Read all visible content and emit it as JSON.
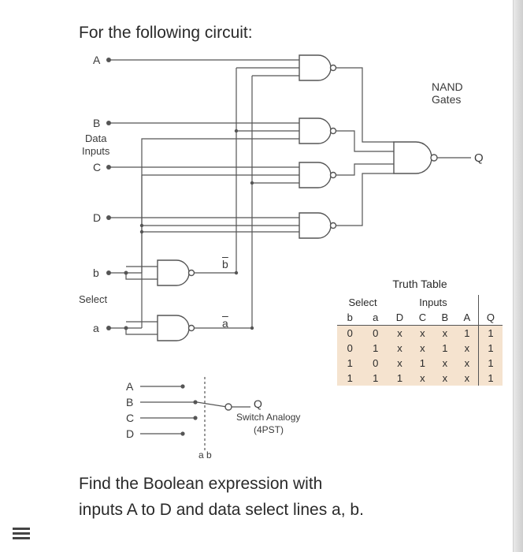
{
  "title": "For the following circuit:",
  "inputs": {
    "A": "A",
    "B": "B",
    "C": "C",
    "D": "D"
  },
  "data_inputs_label1": "Data",
  "data_inputs_label2": "Inputs",
  "select_label": "Select",
  "select_lines": {
    "b": "b",
    "a": "a",
    "b_bar": "b",
    "a_bar": "a"
  },
  "nand_gates_label1": "NAND",
  "nand_gates_label2": "Gates",
  "output_label": "Q",
  "switch": {
    "inputs": {
      "A": "A",
      "B": "B",
      "C": "C",
      "D": "D"
    },
    "output": "Q",
    "label1": "Switch Analogy",
    "label2": "(4PST)",
    "control": "a b"
  },
  "truth_table": {
    "title": "Truth Table",
    "group_select": "Select",
    "group_inputs": "Inputs",
    "cols": [
      "b",
      "a",
      "D",
      "C",
      "B",
      "A",
      "Q"
    ],
    "rows": [
      [
        "0",
        "0",
        "x",
        "x",
        "x",
        "1",
        "1"
      ],
      [
        "0",
        "1",
        "x",
        "x",
        "1",
        "x",
        "1"
      ],
      [
        "1",
        "0",
        "x",
        "1",
        "x",
        "x",
        "1"
      ],
      [
        "1",
        "1",
        "1",
        "x",
        "x",
        "x",
        "1"
      ]
    ]
  },
  "bottom_prompt_line1": "Find the Boolean expression with",
  "bottom_prompt_line2": "inputs A to D and data select lines a, b.",
  "chart_data": {
    "type": "table",
    "title": "4-to-1 Multiplexer (NAND implementation) Truth Table",
    "columns": [
      "b",
      "a",
      "D",
      "C",
      "B",
      "A",
      "Q"
    ],
    "rows": [
      [
        0,
        0,
        "x",
        "x",
        "x",
        1,
        1
      ],
      [
        0,
        1,
        "x",
        "x",
        1,
        "x",
        1
      ],
      [
        1,
        0,
        "x",
        1,
        "x",
        "x",
        1
      ],
      [
        1,
        1,
        1,
        "x",
        "x",
        "x",
        1
      ]
    ],
    "inputs": {
      "data": [
        "A",
        "B",
        "C",
        "D"
      ],
      "select": [
        "a",
        "b"
      ],
      "output": "Q"
    },
    "gate_type": "NAND"
  }
}
